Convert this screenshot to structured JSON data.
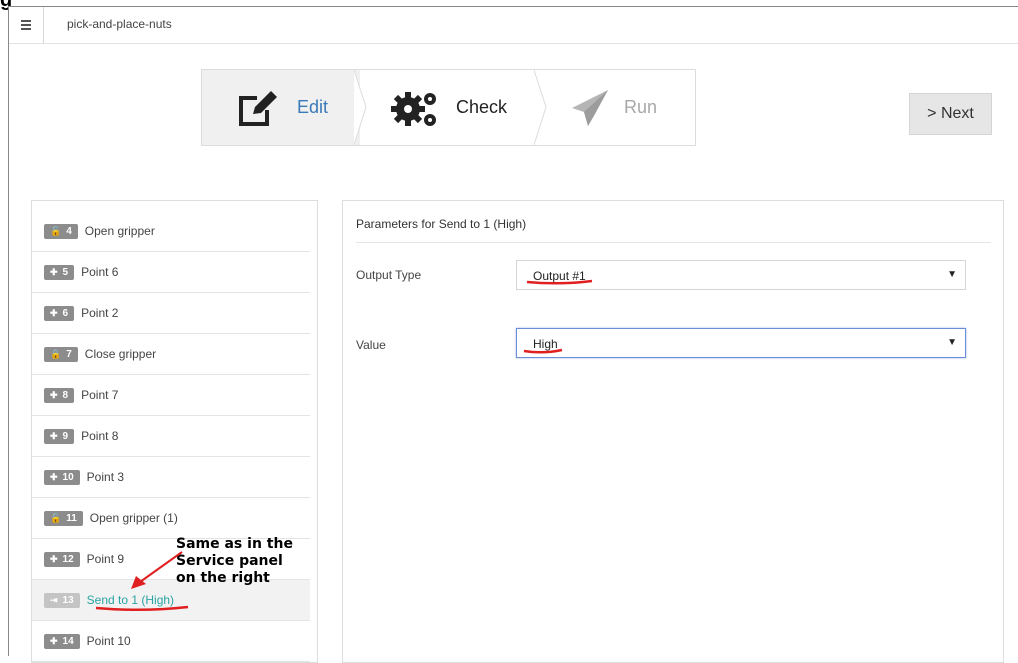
{
  "cut_word": "g",
  "app": {
    "title": "pick-and-place-nuts"
  },
  "stepper": {
    "steps": [
      {
        "label": "Edit",
        "state": "active"
      },
      {
        "label": "Check",
        "state": "available"
      },
      {
        "label": "Run",
        "state": "disabled"
      }
    ]
  },
  "next_button": {
    "label": "> Next"
  },
  "list": {
    "items": [
      {
        "num": "4",
        "icon": "unlock-icon",
        "glyph": "🔓",
        "label": "Open gripper"
      },
      {
        "num": "5",
        "icon": "pin-icon",
        "glyph": "✚",
        "label": "Point 6"
      },
      {
        "num": "6",
        "icon": "pin-icon",
        "glyph": "✚",
        "label": "Point 2"
      },
      {
        "num": "7",
        "icon": "lock-icon",
        "glyph": "🔒",
        "label": "Close gripper"
      },
      {
        "num": "8",
        "icon": "pin-icon",
        "glyph": "✚",
        "label": "Point 7"
      },
      {
        "num": "9",
        "icon": "pin-icon",
        "glyph": "✚",
        "label": "Point 8"
      },
      {
        "num": "10",
        "icon": "pin-icon",
        "glyph": "✚",
        "label": "Point 3"
      },
      {
        "num": "11",
        "icon": "unlock-icon",
        "glyph": "🔓",
        "label": "Open gripper (1)"
      },
      {
        "num": "12",
        "icon": "pin-icon",
        "glyph": "✚",
        "label": "Point 9"
      },
      {
        "num": "13",
        "icon": "output-icon",
        "glyph": "⇥",
        "label": "Send to 1 (High)",
        "selected": true
      },
      {
        "num": "14",
        "icon": "pin-icon",
        "glyph": "✚",
        "label": "Point 10"
      }
    ]
  },
  "parameters": {
    "title": "Parameters for  Send to 1 (High)",
    "fields": [
      {
        "label": "Output Type",
        "value": "Output #1"
      },
      {
        "label": "Value",
        "value": "High"
      }
    ]
  },
  "annotation": {
    "text": "Same as in the\nService panel\non the right",
    "color": "#e02020"
  }
}
